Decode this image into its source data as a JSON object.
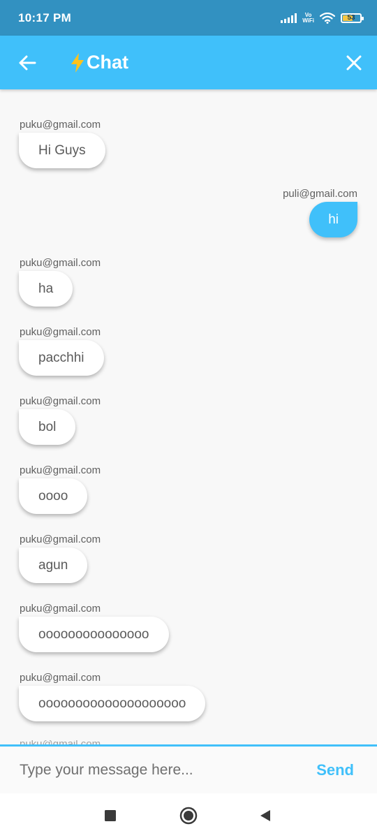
{
  "status_bar": {
    "time": "10:17 PM",
    "vowifi_top": "Vo",
    "vowifi_bottom": "WiFi",
    "battery": "53"
  },
  "app_bar": {
    "title": "Chat",
    "title_icon": "lightning-bolt-icon",
    "back_icon": "arrow-left-icon",
    "close_icon": "close-icon"
  },
  "messages": [
    {
      "sender": "puku@gmail.com",
      "text": "Hi Guys",
      "side": "left"
    },
    {
      "sender": "puli@gmail.com",
      "text": "hi",
      "side": "right"
    },
    {
      "sender": "puku@gmail.com",
      "text": "ha",
      "side": "left"
    },
    {
      "sender": "puku@gmail.com",
      "text": "pacchhi",
      "side": "left"
    },
    {
      "sender": "puku@gmail.com",
      "text": "bol",
      "side": "left"
    },
    {
      "sender": "puku@gmail.com",
      "text": "oooo",
      "side": "left"
    },
    {
      "sender": "puku@gmail.com",
      "text": "agun",
      "side": "left"
    },
    {
      "sender": "puku@gmail.com",
      "text": "ooooooooooooooo",
      "side": "left"
    },
    {
      "sender": "puku@gmail.com",
      "text": "oooooooooooooooooooo",
      "side": "left"
    }
  ],
  "partial_message": {
    "sender": "puku@gmail.com"
  },
  "composer": {
    "placeholder": "Type your message here...",
    "send_label": "Send"
  },
  "nav_bar": {
    "recents_icon": "square-icon",
    "home_icon": "circle-icon",
    "back_icon": "triangle-back-icon"
  },
  "colors": {
    "accent": "#40c0fa",
    "status_bar": "#3291c1",
    "bolt": "#ffc21d",
    "background": "#f8f8f8"
  }
}
